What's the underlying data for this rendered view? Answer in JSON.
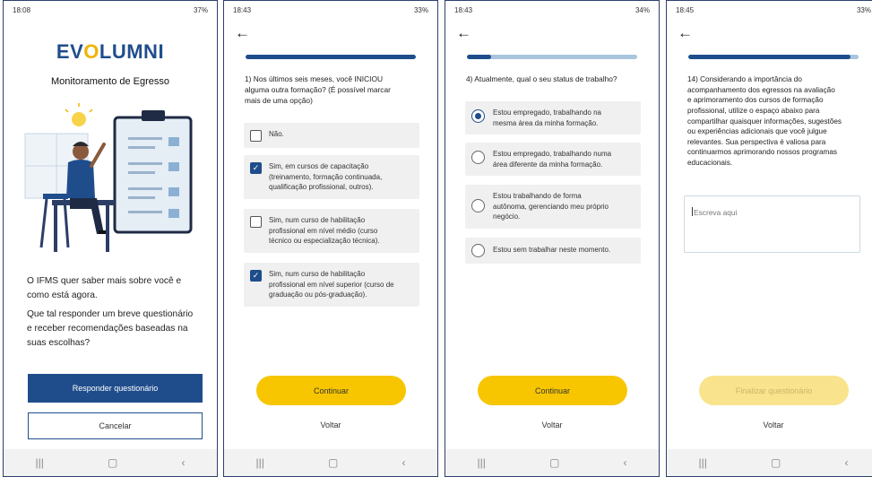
{
  "screen1": {
    "status": {
      "time": "18:08",
      "battery": "37%"
    },
    "logo": {
      "part1": "EV",
      "part2": "O",
      "part3": "LUMNI"
    },
    "title": "Monitoramento de Egresso",
    "para1_line1": "O IFMS quer saber mais sobre você e",
    "para1_line2": "como está agora.",
    "para2_line1": "Que tal responder um breve questionário",
    "para2_line2": "e receber recomendações baseadas na",
    "para2_line3": "suas escolhas?",
    "primary_button": "Responder questionário",
    "secondary_button": "Cancelar"
  },
  "screen2": {
    "status": {
      "time": "18:43",
      "battery": "33%"
    },
    "progress": 1.0,
    "question_line1": "1) Nos últimos seis meses, você INICIOU",
    "question_line2": "alguma outra formação? (É possível marcar",
    "question_line3": "mais de uma opção)",
    "options": [
      {
        "lines": [
          "Não."
        ],
        "checked": false
      },
      {
        "lines": [
          "Sim, em cursos de capacitação",
          "(treinamento, formação continuada,",
          "qualificação profissional, outros)."
        ],
        "checked": true
      },
      {
        "lines": [
          "Sim, num curso de habilitação",
          "profissional em nível médio (curso",
          "técnico ou especialização técnica)."
        ],
        "checked": false
      },
      {
        "lines": [
          "Sim, num curso de habilitação",
          "profissional em nível superior (curso de",
          "graduação ou pós-graduação)."
        ],
        "checked": true
      }
    ],
    "continue_button": "Continuar",
    "back_link": "Voltar"
  },
  "screen3": {
    "status": {
      "time": "18:43",
      "battery": "34%"
    },
    "progress": 0.14,
    "question": "4) Atualmente, qual o seu status de trabalho?",
    "options": [
      {
        "lines": [
          "Estou empregado, trabalhando na",
          "mesma área da minha formação."
        ],
        "selected": true
      },
      {
        "lines": [
          "Estou empregado, trabalhando numa",
          "área diferente da minha formação."
        ],
        "selected": false
      },
      {
        "lines": [
          "Estou trabalhando de forma",
          "autônoma, gerenciando meu próprio",
          "negócio."
        ],
        "selected": false
      },
      {
        "lines": [
          "Estou sem trabalhar neste momento."
        ],
        "selected": false
      }
    ],
    "continue_button": "Continuar",
    "back_link": "Voltar"
  },
  "screen4": {
    "status": {
      "time": "18:45",
      "battery": "33%"
    },
    "progress": 0.95,
    "question_lines": [
      "14) Considerando a importância do",
      "acompanhamento dos egressos na avaliação",
      "e aprimoramento dos cursos de formação",
      "profissional, utilize o espaço abaixo para",
      "compartilhar quaisquer informações, sugestões",
      "ou experiências adicionais que você julgue",
      "relevantes. Sua perspectiva é valiosa para",
      "continuarmos aprimorando nossos programas",
      "educacionais."
    ],
    "textarea_placeholder": "Escreva aqui",
    "finish_button": "Finalizar questionário",
    "back_link": "Voltar"
  },
  "colors": {
    "primary": "#1f4d8c",
    "accent": "#f7c600",
    "progress_track": "#a9c5dd"
  }
}
